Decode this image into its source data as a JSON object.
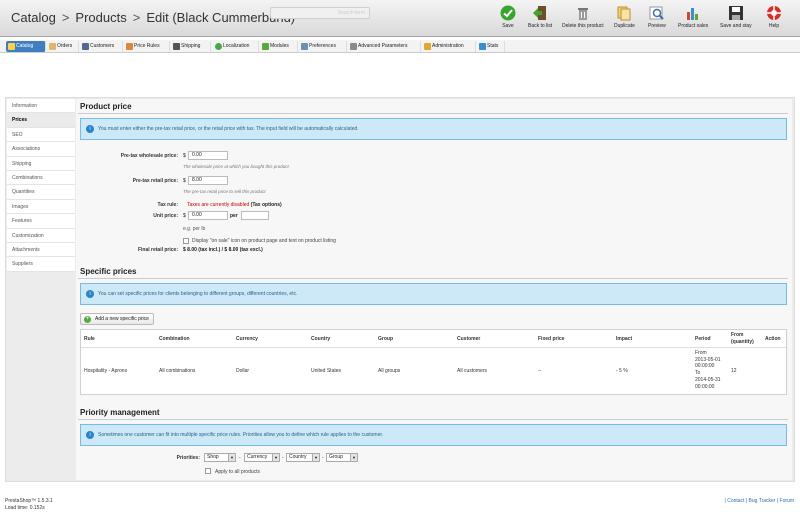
{
  "header": {
    "breadcrumb": [
      "Catalog",
      "Products",
      "Edit (Black Cummerbund)"
    ],
    "search_placeholder": "Search term",
    "toolbar": [
      {
        "label": "Save",
        "icon": "check-circle-icon",
        "color": "#3aa52e"
      },
      {
        "label": "Back to list",
        "icon": "back-arrow-icon",
        "color": "#4b8f2f"
      },
      {
        "label": "Delete this product",
        "icon": "trash-icon",
        "color": "#8a8a8a"
      },
      {
        "label": "Duplicate",
        "icon": "duplicate-icon",
        "color": "#e6b84a"
      },
      {
        "label": "Preview",
        "icon": "magnifier-icon",
        "color": "#6a8fbf"
      },
      {
        "label": "Product sales",
        "icon": "bar-chart-icon",
        "color": "#d0462e"
      },
      {
        "label": "Save and stay",
        "icon": "floppy-disk-icon",
        "color": "#3b3b3b"
      },
      {
        "label": "Help",
        "icon": "help-lifebuoy-icon",
        "color": "#d3302a"
      }
    ]
  },
  "nav": {
    "tabs": [
      {
        "label": "Catalog",
        "icon": "catalog-icon",
        "active": true
      },
      {
        "label": "Orders",
        "icon": "orders-icon"
      },
      {
        "label": "Customers",
        "icon": "customers-icon"
      },
      {
        "label": "Price Rules",
        "icon": "price-rules-icon"
      },
      {
        "label": "Shipping",
        "icon": "shipping-icon"
      },
      {
        "label": "Localization",
        "icon": "localization-icon"
      },
      {
        "label": "Modules",
        "icon": "modules-icon"
      },
      {
        "label": "Preferences",
        "icon": "preferences-icon"
      },
      {
        "label": "Advanced Parameters",
        "icon": "advanced-parameters-icon"
      },
      {
        "label": "Administration",
        "icon": "administration-icon"
      },
      {
        "label": "Stats",
        "icon": "stats-icon"
      }
    ]
  },
  "sidebar": {
    "items": [
      {
        "label": "Information"
      },
      {
        "label": "Prices",
        "active": true
      },
      {
        "label": "SEO"
      },
      {
        "label": "Associations"
      },
      {
        "label": "Shipping"
      },
      {
        "label": "Combinations"
      },
      {
        "label": "Quantities"
      },
      {
        "label": "Images"
      },
      {
        "label": "Features"
      },
      {
        "label": "Customization"
      },
      {
        "label": "Attachments"
      },
      {
        "label": "Suppliers"
      }
    ]
  },
  "product_price": {
    "title": "Product price",
    "info": "You must enter either the pre-tax retail price, or the retail price with tax. The input field will be automatically calculated.",
    "wholesale_label": "Pre-tax wholesale price:",
    "wholesale_currency": "$",
    "wholesale_value": "0.00",
    "wholesale_hint": "The wholesale price at which you bought this product",
    "retail_label": "Pre-tax retail price:",
    "retail_currency": "$",
    "retail_value": "8.00",
    "retail_hint": "The pre-tax retail price to sell this product",
    "tax_label": "Tax rule:",
    "tax_disabled_text": "Taxes are currently disabled",
    "tax_options_link": "(Tax options)",
    "unit_label": "Unit price:",
    "unit_currency": "$",
    "unit_value": "0.00",
    "unit_per": "per",
    "unit_per_value": "",
    "unit_hint": "e.g. per lb",
    "on_sale_text": "Display \"on sale\" icon on product page and text on product listing",
    "final_label": "Final retail price:",
    "final_value": "$ 8.00 (tax incl.) / $ 8.00 (tax excl.)"
  },
  "specific_prices": {
    "title": "Specific prices",
    "info": "You can set specific prices for clients belonging to different groups, different countries, etc.",
    "add_button": "Add a new specific price",
    "columns": [
      "Rule",
      "Combination",
      "Currency",
      "Country",
      "Group",
      "Customer",
      "Fixed price",
      "Impact",
      "Period",
      "From (quantity)",
      "Action"
    ],
    "rows": [
      {
        "rule": "Hospitality - Aprons",
        "combination": "All combinations",
        "currency": "Dollar",
        "country": "United States",
        "group": "All groups",
        "customer": "All customers",
        "fixed_price": "--",
        "impact": "- 5 %",
        "period": [
          "From",
          "2013-05-01",
          "00:00:00",
          "To",
          "2014-05-31",
          "00:00:00"
        ],
        "from_quantity": "12",
        "action": ""
      }
    ]
  },
  "priority": {
    "title": "Priority management",
    "info": "Sometimes one customer can fit into multiple specific price rules. Priorities allow you to define which rule applies to the customer.",
    "label": "Priorities:",
    "selects": [
      "Shop",
      "Currency",
      "Country",
      "Group"
    ],
    "separator": "-",
    "apply_all": "Apply to all products"
  },
  "footer": {
    "version": "PrestaShop™ 1.5.3.1",
    "load_time": "Load time: 0.152s",
    "links": "| Contact | Bug Tracker | Forum"
  },
  "colors": {
    "active_tab": "#3f7fbf",
    "info_bg": "#cde9f7",
    "tax_disabled": "#cc0000"
  }
}
